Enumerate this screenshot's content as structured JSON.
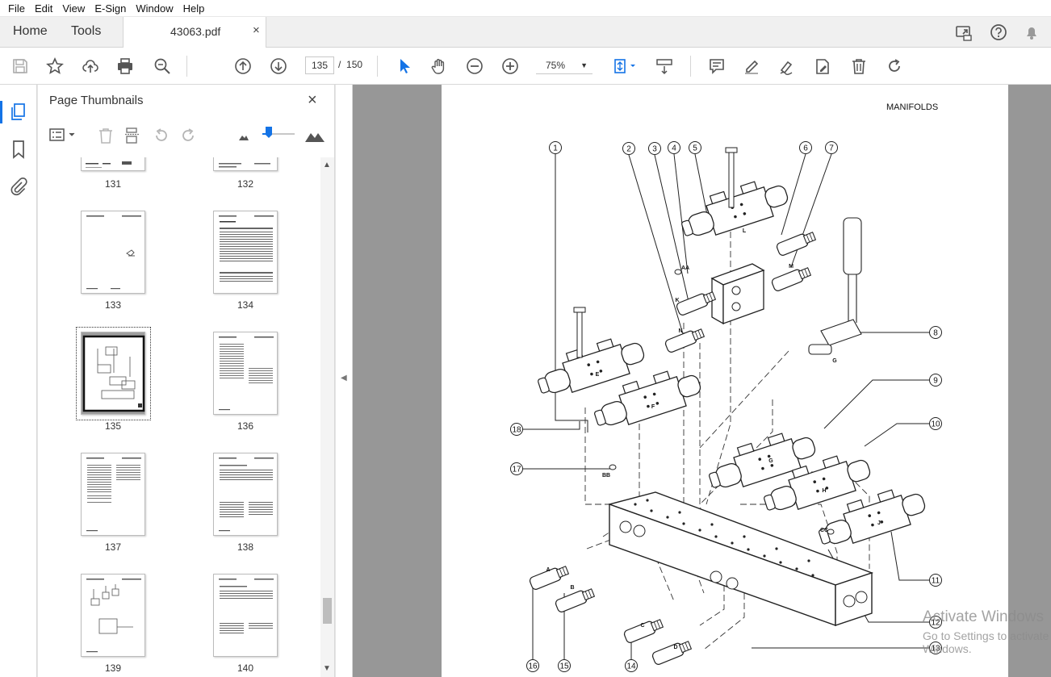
{
  "menu": [
    "File",
    "Edit",
    "View",
    "E-Sign",
    "Window",
    "Help"
  ],
  "tabs": {
    "home": "Home",
    "tools": "Tools",
    "document": "43063.pdf",
    "close": "×"
  },
  "toolbar": {
    "page_current": "135",
    "page_separator": "/",
    "page_total": "150",
    "zoom": "75%"
  },
  "sidebar": {
    "title": "Page Thumbnails",
    "close": "×"
  },
  "thumbnails": [
    {
      "label": "131"
    },
    {
      "label": "132"
    },
    {
      "label": "133"
    },
    {
      "label": "134"
    },
    {
      "label": "135",
      "selected": true
    },
    {
      "label": "136"
    },
    {
      "label": "137"
    },
    {
      "label": "138"
    },
    {
      "label": "139"
    },
    {
      "label": "140"
    }
  ],
  "document": {
    "header": "MANIFOLDS",
    "callouts": [
      "1",
      "2",
      "3",
      "4",
      "5",
      "6",
      "7",
      "8",
      "9",
      "10",
      "11",
      "12",
      "13",
      "14",
      "15",
      "16",
      "17",
      "18"
    ],
    "letters": [
      "AA",
      "K",
      "L",
      "M",
      "N",
      "E",
      "F",
      "G",
      "G",
      "H",
      "J",
      "BB",
      "CC",
      "A",
      "B",
      "C",
      "D"
    ]
  },
  "watermark": {
    "line1": "Activate Windows",
    "line2": "Go to Settings to activate Windows."
  },
  "colors": {
    "accent": "#1473e6",
    "viewer_bg": "#979797"
  }
}
